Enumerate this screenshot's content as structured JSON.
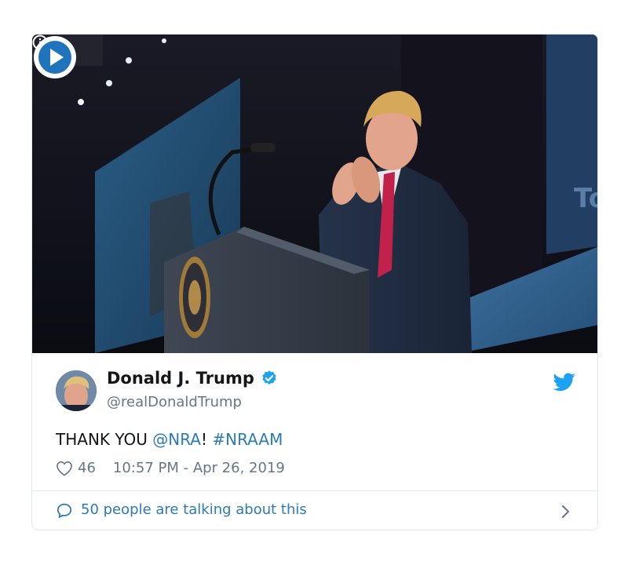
{
  "tweet": {
    "author": {
      "name": "Donald J. Trump",
      "handle": "@realDonaldTrump",
      "verified": true
    },
    "text_before": "THANK YOU ",
    "mention": "@NRA",
    "text_middle": "! ",
    "hashtag": "#NRAAM",
    "likes": "46",
    "timestamp": "10:57 PM - Apr 26, 2019",
    "talking": "50 people are talking about this"
  },
  "colors": {
    "link": "#2b7bb9",
    "verified": "#1da1f2",
    "twitter_bird": "#1da1f2",
    "muted": "#657786",
    "border": "#e1e8ed"
  },
  "icons": {
    "info": "info-icon",
    "play": "play-icon",
    "verified": "verified-badge-icon",
    "bird": "twitter-bird-icon",
    "heart": "heart-icon",
    "comment": "speech-bubble-icon",
    "chevron": "chevron-right-icon"
  }
}
